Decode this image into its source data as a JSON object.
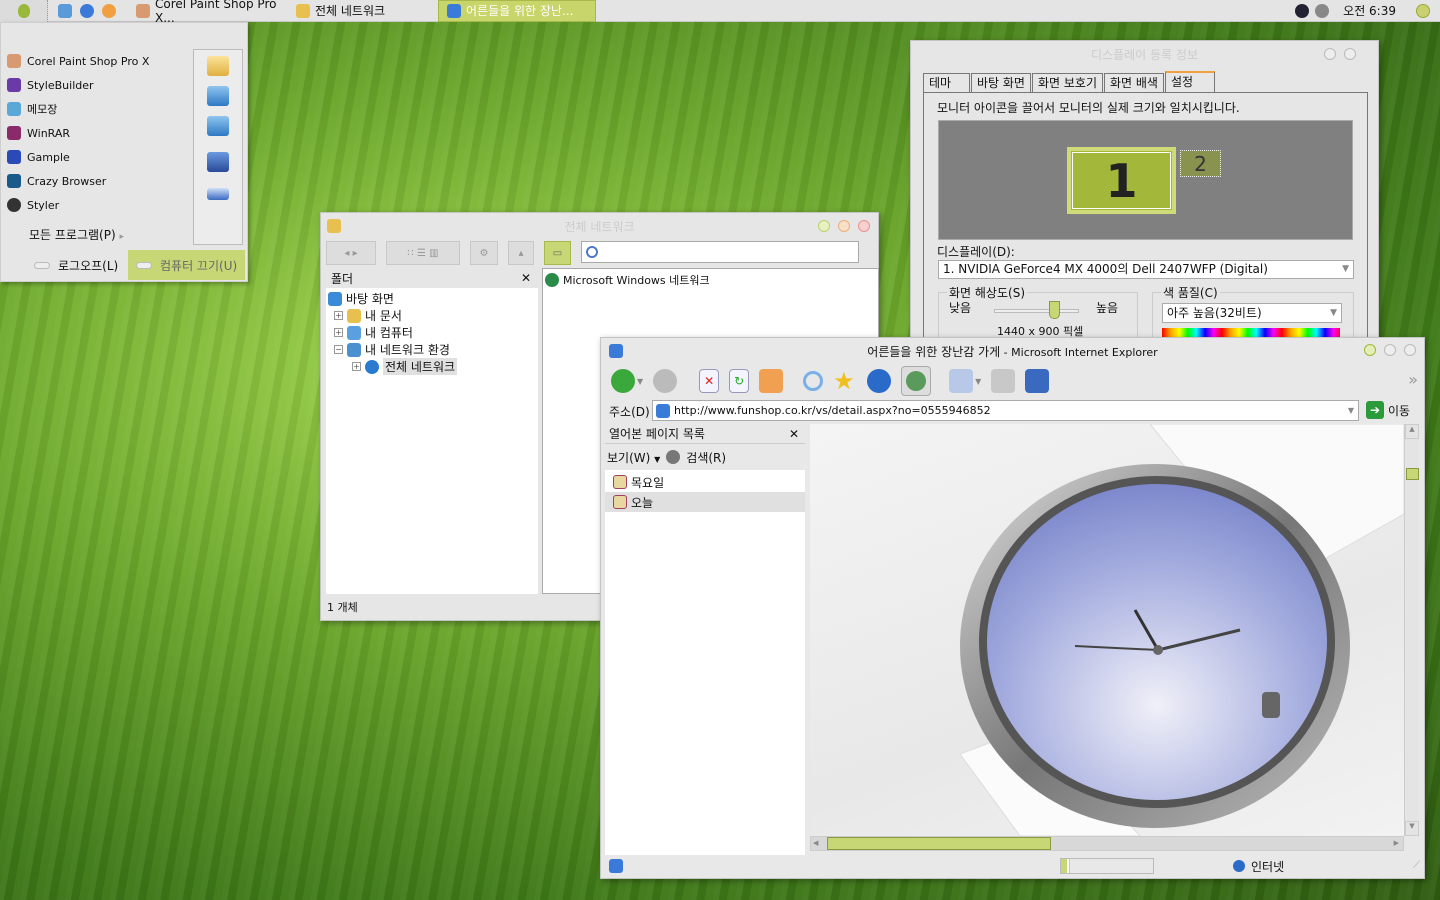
{
  "taskbar": {
    "tasks": [
      {
        "label": "Corel Paint Shop Pro X..."
      },
      {
        "label": "전체 네트워크"
      },
      {
        "label": "어른들을 위한 장난..."
      }
    ],
    "clock": "오전 6:39"
  },
  "start_menu": {
    "programs": [
      {
        "label": "Corel Paint Shop Pro X",
        "color": "#d89a70"
      },
      {
        "label": "StyleBuilder",
        "color": "#6a3aa8"
      },
      {
        "label": "메모장",
        "color": "#5aa8d8"
      },
      {
        "label": "WinRAR",
        "color": "#8a2a6a"
      },
      {
        "label": "Gample",
        "color": "#2a4ab8"
      },
      {
        "label": "Crazy Browser",
        "color": "#1a5a8a"
      },
      {
        "label": "Styler",
        "color": "#333"
      }
    ],
    "all_programs": "모든 프로그램(P)",
    "logoff": "로그오프(L)",
    "shutdown": "컴퓨터 끄기(U)"
  },
  "explorer": {
    "title": "전체 네트워크",
    "folders_label": "폴더",
    "tree": [
      {
        "label": "바탕 화면",
        "expander": ""
      },
      {
        "label": "내 문서",
        "expander": "+"
      },
      {
        "label": "내 컴퓨터",
        "expander": "+"
      },
      {
        "label": "내 네트워크 환경",
        "expander": "−"
      },
      {
        "label": "전체 네트워크",
        "expander": "+"
      }
    ],
    "items": [
      "Microsoft Windows 네트워크"
    ],
    "status": "1 개체"
  },
  "display": {
    "title": "디스플레이 등록 정보",
    "tabs": [
      "테마",
      "바탕 화면",
      "화면 보호기",
      "화면 배색",
      "설정"
    ],
    "instruction": "모니터 아이콘을 끌어서 모니터의 실제 크기와 일치시킵니다.",
    "monitors": [
      "1",
      "2"
    ],
    "display_label": "디스플레이(D):",
    "display_value": "1.  NVIDIA GeForce4 MX 4000의 Dell 2407WFP (Digital)",
    "resolution_label": "화면 해상도(S)",
    "low": "낮음",
    "high": "높음",
    "resolution_value": "1440 x 900 픽셀",
    "resolution_slider": 0.7,
    "color_label": "색 품질(C)",
    "color_value": "아주 높음(32비트)"
  },
  "ie": {
    "title": "어른들을 위한 장난감 가게",
    "title_suffix": " - Microsoft Internet Explorer",
    "address_label": "주소(D)",
    "url": "http://www.funshop.co.kr/vs/detail.aspx?no=0555946852",
    "go": "이동",
    "history_title": "열어본 페이지 목록",
    "view": "보기(W)",
    "search": "검색(R)",
    "history": [
      "목요일",
      "오늘"
    ],
    "zone": "인터넷",
    "progress": 0.1,
    "hscroll": 0.4
  }
}
